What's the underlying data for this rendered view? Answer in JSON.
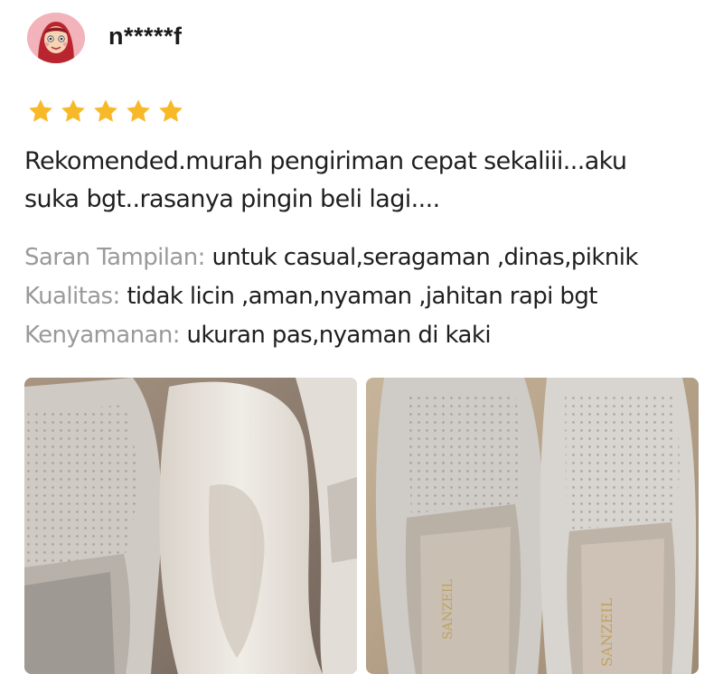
{
  "review": {
    "username": "n*****f",
    "rating": 5,
    "rating_max": 5,
    "text_line1": "Rekomended.murah pengiriman cepat sekaliii...aku",
    "text_line2": "suka bgt..rasanya pingin beli lagi....",
    "attributes": [
      {
        "label": "Saran Tampilan:",
        "value": "untuk casual,seragaman ,dinas,piknik"
      },
      {
        "label": "Kualitas:",
        "value": "tidak licin ,aman,nyaman ,jahitan rapi bgt"
      },
      {
        "label": "Kenyamanan:",
        "value": "ukuran pas,nyaman di kaki"
      }
    ]
  },
  "icons": {
    "avatar": "cartoon-hijab-avatar",
    "star": "star-icon"
  },
  "colors": {
    "star": "#f7b928",
    "label_gray": "#9a9a9a",
    "text": "#1f1f1f"
  },
  "photos": [
    {
      "alt_name": "review-photo-shoe-side-and-insole"
    },
    {
      "alt_name": "review-photo-pair-of-shoes",
      "insole_text": "SANZEIL"
    }
  ]
}
